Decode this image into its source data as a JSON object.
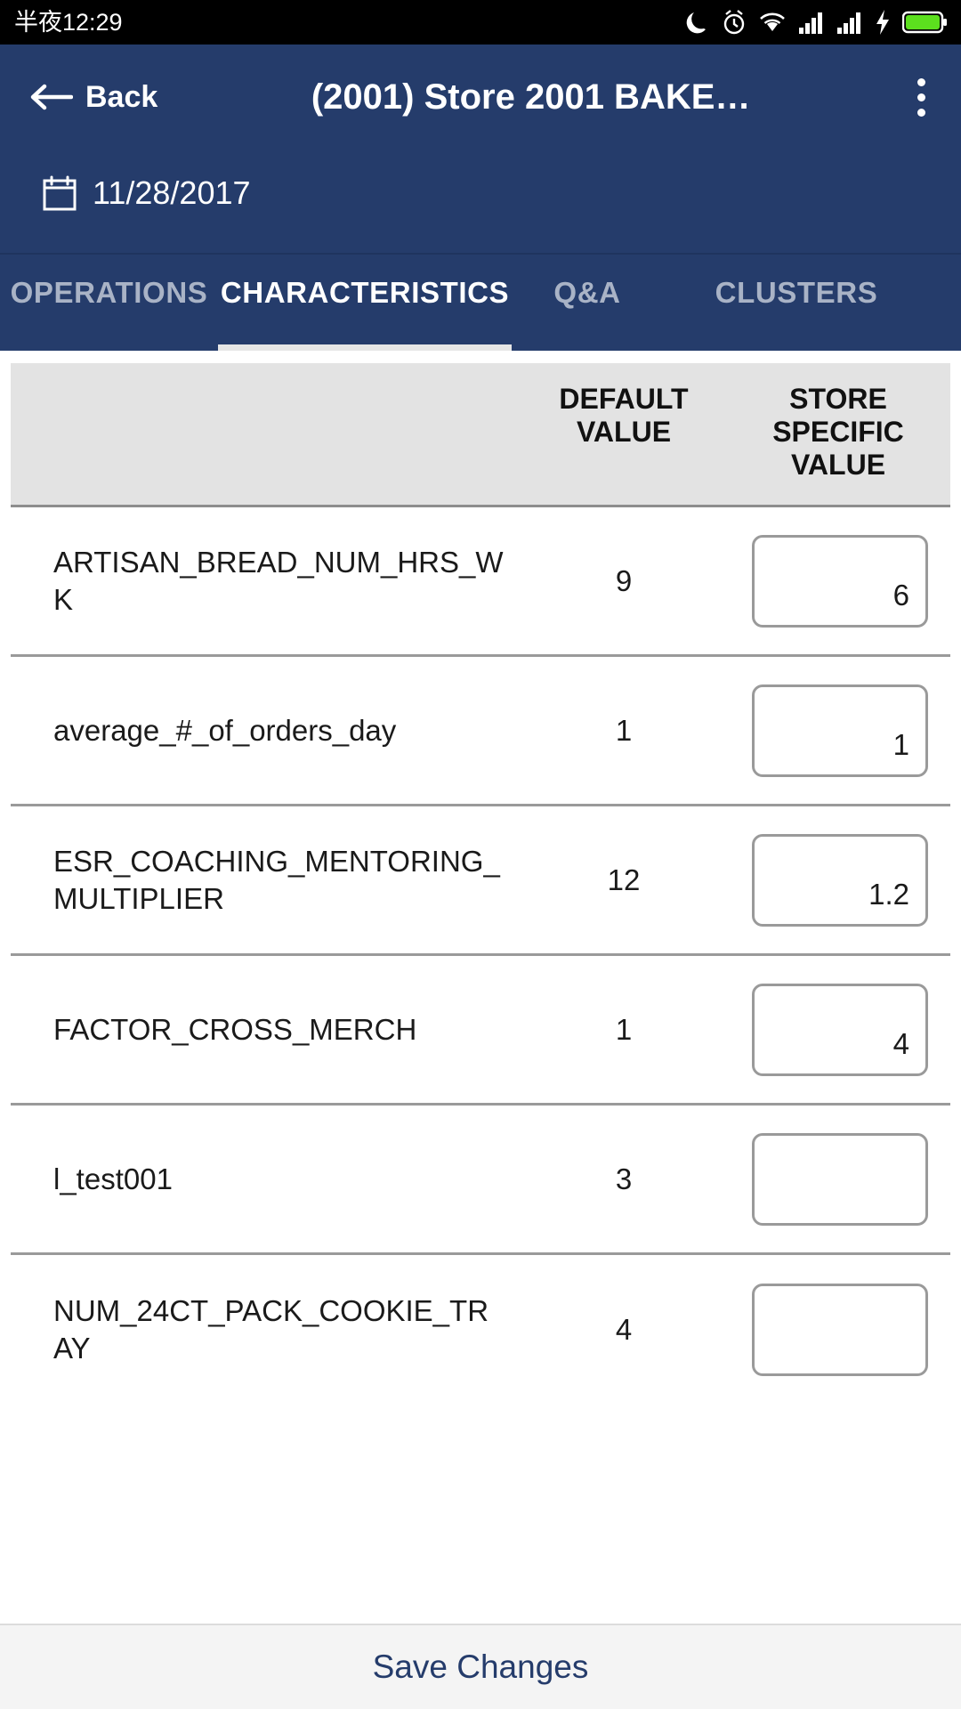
{
  "status_bar": {
    "clock": "半夜12:29",
    "icons": [
      "moon-icon",
      "alarm-icon",
      "wifi-icon",
      "signal-icon-1",
      "signal-icon-2",
      "charging-bolt-icon",
      "battery-icon"
    ],
    "battery_color": "#5ce01e"
  },
  "header": {
    "back_label": "Back",
    "title": "(2001) Store 2001  BAKE…",
    "date": "11/28/2017",
    "menu_icon": "kebab-menu-icon",
    "calendar_icon": "calendar-icon",
    "background": "#253C6B"
  },
  "tabs": [
    {
      "label": "OPERATIONS",
      "active": false
    },
    {
      "label": "CHARACTERISTICS",
      "active": true
    },
    {
      "label": "Q&A",
      "active": false
    },
    {
      "label": "CLUSTERS",
      "active": false
    }
  ],
  "table": {
    "headers": {
      "name": "",
      "default_value": "DEFAULT VALUE",
      "store_specific_value": "STORE SPECIFIC VALUE"
    },
    "rows": [
      {
        "name": "ARTISAN_BREAD_NUM_HRS_WK",
        "default_value": "9",
        "store_value": "6"
      },
      {
        "name": "average_#_of_orders_day",
        "default_value": "1",
        "store_value": "1"
      },
      {
        "name": "ESR_COACHING_MENTORING_MULTIPLIER",
        "default_value": "12",
        "store_value": "1.2"
      },
      {
        "name": "FACTOR_CROSS_MERCH",
        "default_value": "1",
        "store_value": "4"
      },
      {
        "name": "l_test001",
        "default_value": "3",
        "store_value": ""
      },
      {
        "name": "NUM_24CT_PACK_COOKIE_TRAY",
        "default_value": "4",
        "store_value": ""
      }
    ]
  },
  "footer": {
    "save_label": "Save Changes",
    "accent": "#253C6B"
  }
}
